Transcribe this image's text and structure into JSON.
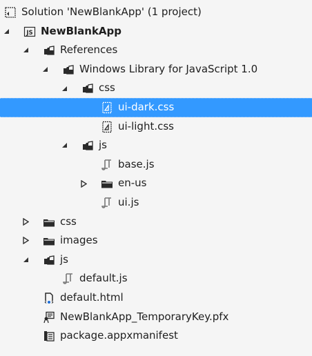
{
  "solution_explorer": {
    "selected_color": "#3399ff",
    "items": [
      {
        "label": "Solution 'NewBlankApp' (1 project)",
        "level": 0,
        "expander": "none",
        "icon": "solution-icon"
      },
      {
        "label": "NewBlankApp",
        "level": 1,
        "expander": "expanded",
        "icon": "js-project-icon",
        "bold": true
      },
      {
        "label": "References",
        "level": 2,
        "expander": "expanded",
        "icon": "folder-open-icon"
      },
      {
        "label": "Windows Library for JavaScript 1.0",
        "level": 3,
        "expander": "expanded",
        "icon": "folder-open-icon"
      },
      {
        "label": "css",
        "level": 4,
        "expander": "expanded",
        "icon": "folder-open-icon"
      },
      {
        "label": "ui-dark.css",
        "level": 5,
        "expander": "none",
        "icon": "css-file-icon",
        "selected": true
      },
      {
        "label": "ui-light.css",
        "level": 5,
        "expander": "none",
        "icon": "css-file-icon"
      },
      {
        "label": "js",
        "level": 4,
        "expander": "expanded",
        "icon": "folder-open-icon"
      },
      {
        "label": "base.js",
        "level": 5,
        "expander": "none",
        "icon": "js-file-icon"
      },
      {
        "label": "en-us",
        "level": 5,
        "expander": "collapsed",
        "icon": "folder-closed-icon",
        "expander_level": 4
      },
      {
        "label": "ui.js",
        "level": 5,
        "expander": "none",
        "icon": "js-file-icon"
      },
      {
        "label": "css",
        "level": 2,
        "expander": "collapsed",
        "icon": "folder-closed-icon",
        "expander_level": 1
      },
      {
        "label": "images",
        "level": 2,
        "expander": "collapsed",
        "icon": "folder-closed-icon",
        "expander_level": 1
      },
      {
        "label": "js",
        "level": 2,
        "expander": "expanded",
        "icon": "folder-open-icon",
        "expander_level": 1
      },
      {
        "label": "default.js",
        "level": 3,
        "expander": "none",
        "icon": "js-file-icon"
      },
      {
        "label": "default.html",
        "level": 2,
        "expander": "none",
        "icon": "html-file-icon"
      },
      {
        "label": "NewBlankApp_TemporaryKey.pfx",
        "level": 2,
        "expander": "none",
        "icon": "certificate-icon"
      },
      {
        "label": "package.appxmanifest",
        "level": 2,
        "expander": "none",
        "icon": "manifest-icon"
      }
    ]
  }
}
